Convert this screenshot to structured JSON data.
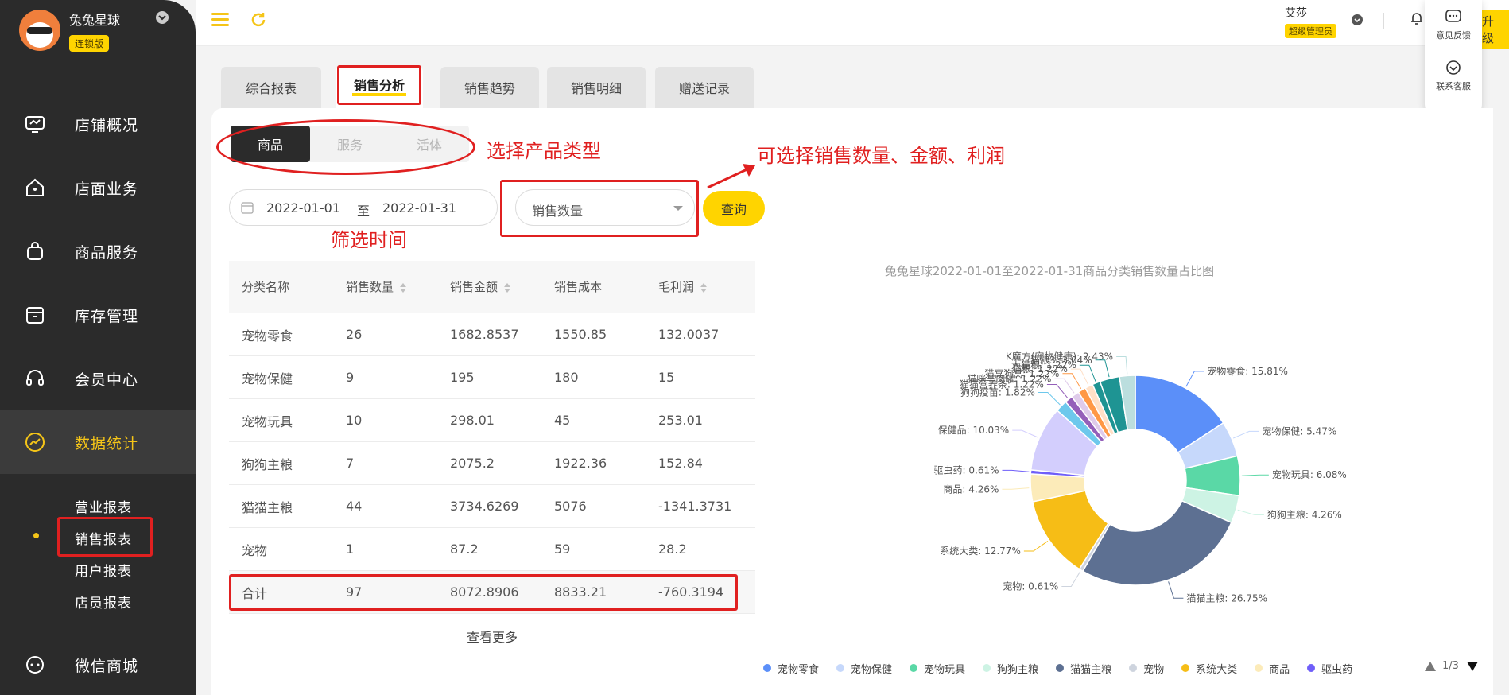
{
  "store": {
    "name": "兔兔星球",
    "badge": "连锁版"
  },
  "nav": [
    {
      "label": "店铺概况",
      "icon": "monitor-icon"
    },
    {
      "label": "店面业务",
      "icon": "home-icon"
    },
    {
      "label": "商品服务",
      "icon": "bag-icon"
    },
    {
      "label": "库存管理",
      "icon": "box-icon"
    },
    {
      "label": "会员中心",
      "icon": "headset-icon"
    },
    {
      "label": "数据统计",
      "icon": "trend-icon"
    },
    {
      "label": "微信商城",
      "icon": "chat-icon"
    }
  ],
  "subnav": [
    "营业报表",
    "销售报表",
    "用户报表",
    "店员报表"
  ],
  "header": {
    "user": "艾莎",
    "role": "超级管理员",
    "upgrade": "升级"
  },
  "float_panel": {
    "feedback": "意见反馈",
    "contact": "联系客服"
  },
  "tabs": [
    "综合报表",
    "销售分析",
    "销售趋势",
    "销售明细",
    "赠送记录"
  ],
  "segments": [
    "商品",
    "服务",
    "活体"
  ],
  "filter": {
    "start": "2022-01-01",
    "to": "至",
    "end": "2022-01-31",
    "metric": "销售数量",
    "query": "查询"
  },
  "table": {
    "headers": [
      "分类名称",
      "销售数量",
      "销售金额",
      "销售成本",
      "毛利润"
    ],
    "rows": [
      [
        "宠物零食",
        "26",
        "1682.8537",
        "1550.85",
        "132.0037"
      ],
      [
        "宠物保健",
        "9",
        "195",
        "180",
        "15"
      ],
      [
        "宠物玩具",
        "10",
        "298.01",
        "45",
        "253.01"
      ],
      [
        "狗狗主粮",
        "7",
        "2075.2",
        "1922.36",
        "152.84"
      ],
      [
        "猫猫主粮",
        "44",
        "3734.6269",
        "5076",
        "-1341.3731"
      ],
      [
        "宠物",
        "1",
        "87.2",
        "59",
        "28.2"
      ]
    ],
    "total": [
      "合计",
      "97",
      "8072.8906",
      "8833.21",
      "-760.3194"
    ],
    "more": "查看更多"
  },
  "annotations": {
    "type": "选择产品类型",
    "time": "筛选时间",
    "metric": "可选择销售数量、金额、利润"
  },
  "chart_title": "兔兔星球2022-01-01至2022-01-31商品分类销售数量占比图",
  "chart_data": {
    "type": "pie",
    "title": "兔兔星球2022-01-01至2022-01-31商品分类销售数量占比图",
    "series": [
      {
        "name": "宠物零食",
        "value": 15.81,
        "color": "#5b8ff9"
      },
      {
        "name": "宠物保健",
        "value": 5.47,
        "color": "#c6d8fb"
      },
      {
        "name": "宠物玩具",
        "value": 6.08,
        "color": "#5ad8a6"
      },
      {
        "name": "狗狗主粮",
        "value": 4.26,
        "color": "#cdf3e4"
      },
      {
        "name": "猫猫主粮",
        "value": 26.75,
        "color": "#5d7092"
      },
      {
        "name": "宠物",
        "value": 0.61,
        "color": "#ced4de"
      },
      {
        "name": "系统大类",
        "value": 12.77,
        "color": "#f6bd16"
      },
      {
        "name": "商品",
        "value": 4.26,
        "color": "#fcebb9"
      },
      {
        "name": "驱虫药",
        "value": 0.61,
        "color": "#6f5ef9"
      },
      {
        "name": "保健品",
        "value": 10.03,
        "color": "#d3cefd"
      },
      {
        "name": "狗狗疫苗",
        "value": 1.82,
        "color": "#6dc8ec"
      },
      {
        "name": "猫猫营养条",
        "value": 1.22,
        "color": "#945fb9"
      },
      {
        "name": "猫咪羊肉罐",
        "value": 1.22,
        "color": "#dfcbea"
      },
      {
        "name": "猫窝狗窝",
        "value": 1.22,
        "color": "#ff9845"
      },
      {
        "name": "猫粮",
        "value": 1.22,
        "color": "#ffe0c7"
      },
      {
        "name": "大猫粮",
        "value": 1.22,
        "color": "#1e9493"
      },
      {
        "name": "猫粮3",
        "value": 3.04,
        "color": "#1e9493"
      },
      {
        "name": "K魔方(宠物健康)",
        "value": 2.43,
        "color": "#bbdede"
      }
    ],
    "labels": [
      "宠物零食: 15.81%",
      "宠物保健: 5.47%",
      "宠物玩具: 6.08%",
      "狗狗主粮: 4.26%",
      "猫猫主粮: 26.75%",
      "宠物: 0.61%",
      "系统大类: 12.77%",
      "商品: 4.26%",
      "驱虫药: 0.61%",
      "保健品: 10.03%",
      "狗狗疫苗: 1.82%",
      "猫猫营养条: 1.22%",
      "猫咪羊肉罐: 1.22%",
      "猫窝狗窝: 1.22%",
      "猫粮: 1.22%",
      "大猫粮: 1.22%",
      "猫粮3: 3.04%",
      "K魔方(宠物健康): 2.43%"
    ],
    "legend_placement": "bottom",
    "legend_visible": [
      "宠物零食",
      "宠物保健",
      "宠物玩具",
      "狗狗主粮",
      "猫猫主粮",
      "宠物",
      "系统大类",
      "商品",
      "驱虫药"
    ],
    "legend_page": "1/3"
  }
}
